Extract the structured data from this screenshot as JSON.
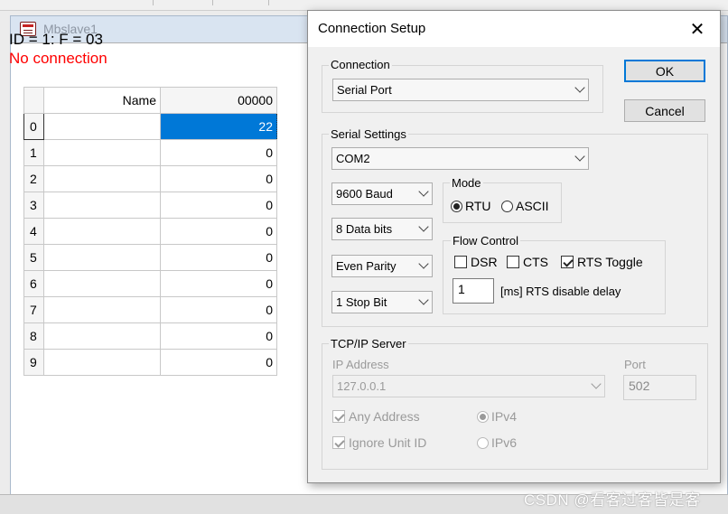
{
  "child_window": {
    "title": "Mbslave1",
    "status_id": "ID = 1: F = 03",
    "status_error": "No connection"
  },
  "grid": {
    "header_name": "Name",
    "header_address": "00000",
    "rows": [
      {
        "index": "0",
        "name": "",
        "value": "22"
      },
      {
        "index": "1",
        "name": "",
        "value": "0"
      },
      {
        "index": "2",
        "name": "",
        "value": "0"
      },
      {
        "index": "3",
        "name": "",
        "value": "0"
      },
      {
        "index": "4",
        "name": "",
        "value": "0"
      },
      {
        "index": "5",
        "name": "",
        "value": "0"
      },
      {
        "index": "6",
        "name": "",
        "value": "0"
      },
      {
        "index": "7",
        "name": "",
        "value": "0"
      },
      {
        "index": "8",
        "name": "",
        "value": "0"
      },
      {
        "index": "9",
        "name": "",
        "value": "0"
      }
    ]
  },
  "dialog": {
    "title": "Connection Setup",
    "ok_label": "OK",
    "cancel_label": "Cancel",
    "connection": {
      "group_label": "Connection",
      "selected": "Serial Port"
    },
    "serial": {
      "group_label": "Serial Settings",
      "port": "COM2",
      "baud": "9600 Baud",
      "data_bits": "8 Data bits",
      "parity": "Even Parity",
      "stop_bits": "1 Stop Bit",
      "mode_label": "Mode",
      "mode_rtu": "RTU",
      "mode_ascii": "ASCII",
      "flow_label": "Flow Control",
      "flow_dsr": "DSR",
      "flow_cts": "CTS",
      "flow_rts_toggle": "RTS Toggle",
      "rts_delay_value": "1",
      "rts_delay_label": "[ms] RTS disable delay"
    },
    "tcp": {
      "group_label": "TCP/IP Server",
      "ip_label": "IP Address",
      "ip_value": "127.0.0.1",
      "port_label": "Port",
      "port_value": "502",
      "any_address": "Any Address",
      "ignore_unit_id": "Ignore Unit ID",
      "ipv4": "IPv4",
      "ipv6": "IPv6"
    }
  },
  "watermark": "CSDN @看客过客皆是客",
  "colors": {
    "selection": "#0078d7",
    "error_text": "#ff0000",
    "dialog_bg": "#f0f0f0"
  }
}
